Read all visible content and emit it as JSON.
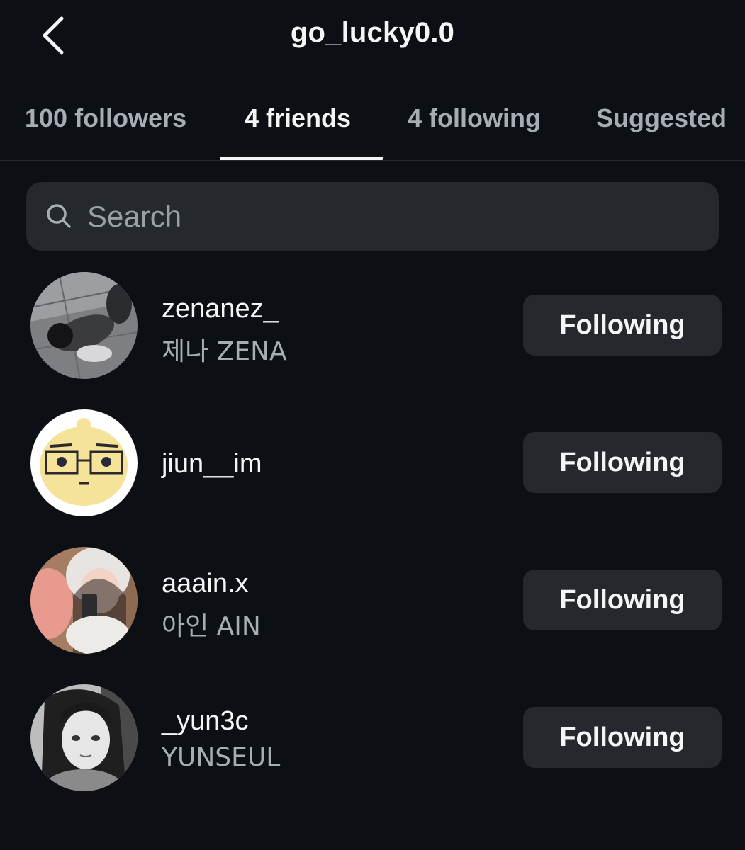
{
  "header": {
    "title": "go_lucky0.0",
    "back_icon": "chevron-left-icon"
  },
  "tabs": [
    {
      "label": "100 followers",
      "active": false
    },
    {
      "label": "4 friends",
      "active": true
    },
    {
      "label": "4 following",
      "active": false
    },
    {
      "label": "Suggested",
      "active": false
    }
  ],
  "search": {
    "placeholder": "Search",
    "value": "",
    "icon": "search-icon"
  },
  "friends": [
    {
      "username": "zenanez_",
      "full_name": "제나 ZENA",
      "button_label": "Following",
      "avatar": "photo-person-lying-on-floor"
    },
    {
      "username": "jiun__im",
      "full_name": "",
      "button_label": "Following",
      "avatar": "cartoon-character-with-glasses"
    },
    {
      "username": "aaain.x",
      "full_name": "아인 AIN",
      "button_label": "Following",
      "avatar": "photo-mirror-selfie"
    },
    {
      "username": "_yun3c",
      "full_name": "YUNSEUL",
      "button_label": "Following",
      "avatar": "photo-black-and-white-portrait"
    }
  ],
  "colors": {
    "background": "#0c1014",
    "surface": "#25292e",
    "text_primary": "#f5f5f5",
    "text_secondary": "#a8acb3"
  }
}
